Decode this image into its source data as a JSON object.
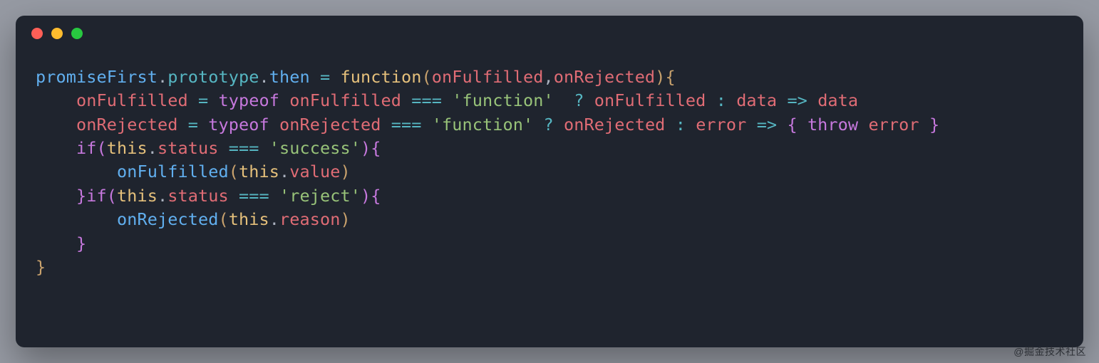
{
  "watermark": "@掘金技术社区",
  "colors": {
    "background": "#969aa3",
    "window": "#1f242e",
    "red": "#ff5f57",
    "yellow": "#febc2e",
    "green": "#28c840"
  },
  "code": {
    "language": "javascript",
    "plain": "promiseFirst.prototype.then = function(onFulfilled,onRejected){\n    onFulfilled = typeof onFulfilled === 'function'  ? onFulfilled : data => data\n    onRejected = typeof onRejected === 'function' ? onRejected : error => { throw error }\n    if(this.status === 'success'){\n        onFulfilled(this.value)\n    }if(this.status === 'reject'){\n        onRejected(this.reason)\n    }\n}",
    "tokens": [
      [
        {
          "t": "promiseFirst",
          "c": "c-id"
        },
        {
          "t": ".",
          "c": "c-punct"
        },
        {
          "t": "prototype",
          "c": "c-prop"
        },
        {
          "t": ".",
          "c": "c-punct"
        },
        {
          "t": "then",
          "c": "c-id"
        },
        {
          "t": " ",
          "c": ""
        },
        {
          "t": "=",
          "c": "c-op"
        },
        {
          "t": " ",
          "c": ""
        },
        {
          "t": "function",
          "c": "c-func"
        },
        {
          "t": "(",
          "c": "c-brace"
        },
        {
          "t": "onFulfilled",
          "c": "c-param"
        },
        {
          "t": ",",
          "c": "c-punct"
        },
        {
          "t": "onRejected",
          "c": "c-param"
        },
        {
          "t": ")",
          "c": "c-brace"
        },
        {
          "t": "{",
          "c": "c-brace"
        }
      ],
      [
        {
          "t": "    ",
          "c": ""
        },
        {
          "t": "onFulfilled",
          "c": "c-param"
        },
        {
          "t": " ",
          "c": ""
        },
        {
          "t": "=",
          "c": "c-op"
        },
        {
          "t": " ",
          "c": ""
        },
        {
          "t": "typeof",
          "c": "c-kw"
        },
        {
          "t": " ",
          "c": ""
        },
        {
          "t": "onFulfilled",
          "c": "c-param"
        },
        {
          "t": " ",
          "c": ""
        },
        {
          "t": "===",
          "c": "c-op"
        },
        {
          "t": " ",
          "c": ""
        },
        {
          "t": "'function'",
          "c": "c-str"
        },
        {
          "t": "  ",
          "c": ""
        },
        {
          "t": "?",
          "c": "c-op"
        },
        {
          "t": " ",
          "c": ""
        },
        {
          "t": "onFulfilled",
          "c": "c-param"
        },
        {
          "t": " ",
          "c": ""
        },
        {
          "t": ":",
          "c": "c-op"
        },
        {
          "t": " ",
          "c": ""
        },
        {
          "t": "data",
          "c": "c-param"
        },
        {
          "t": " ",
          "c": ""
        },
        {
          "t": "=>",
          "c": "c-op"
        },
        {
          "t": " ",
          "c": ""
        },
        {
          "t": "data",
          "c": "c-param"
        }
      ],
      [
        {
          "t": "    ",
          "c": ""
        },
        {
          "t": "onRejected",
          "c": "c-param"
        },
        {
          "t": " ",
          "c": ""
        },
        {
          "t": "=",
          "c": "c-op"
        },
        {
          "t": " ",
          "c": ""
        },
        {
          "t": "typeof",
          "c": "c-kw"
        },
        {
          "t": " ",
          "c": ""
        },
        {
          "t": "onRejected",
          "c": "c-param"
        },
        {
          "t": " ",
          "c": ""
        },
        {
          "t": "===",
          "c": "c-op"
        },
        {
          "t": " ",
          "c": ""
        },
        {
          "t": "'function'",
          "c": "c-str"
        },
        {
          "t": " ",
          "c": ""
        },
        {
          "t": "?",
          "c": "c-op"
        },
        {
          "t": " ",
          "c": ""
        },
        {
          "t": "onRejected",
          "c": "c-param"
        },
        {
          "t": " ",
          "c": ""
        },
        {
          "t": ":",
          "c": "c-op"
        },
        {
          "t": " ",
          "c": ""
        },
        {
          "t": "error",
          "c": "c-param"
        },
        {
          "t": " ",
          "c": ""
        },
        {
          "t": "=>",
          "c": "c-op"
        },
        {
          "t": " ",
          "c": ""
        },
        {
          "t": "{",
          "c": "c-brace2"
        },
        {
          "t": " ",
          "c": ""
        },
        {
          "t": "throw",
          "c": "c-kw"
        },
        {
          "t": " ",
          "c": ""
        },
        {
          "t": "error",
          "c": "c-param"
        },
        {
          "t": " ",
          "c": ""
        },
        {
          "t": "}",
          "c": "c-brace2"
        }
      ],
      [
        {
          "t": "    ",
          "c": ""
        },
        {
          "t": "if",
          "c": "c-kw"
        },
        {
          "t": "(",
          "c": "c-brace2"
        },
        {
          "t": "this",
          "c": "c-func"
        },
        {
          "t": ".",
          "c": "c-punct"
        },
        {
          "t": "status",
          "c": "c-param"
        },
        {
          "t": " ",
          "c": ""
        },
        {
          "t": "===",
          "c": "c-op"
        },
        {
          "t": " ",
          "c": ""
        },
        {
          "t": "'success'",
          "c": "c-str"
        },
        {
          "t": ")",
          "c": "c-brace2"
        },
        {
          "t": "{",
          "c": "c-brace2"
        }
      ],
      [
        {
          "t": "        ",
          "c": ""
        },
        {
          "t": "onFulfilled",
          "c": "c-id"
        },
        {
          "t": "(",
          "c": "c-brace"
        },
        {
          "t": "this",
          "c": "c-func"
        },
        {
          "t": ".",
          "c": "c-punct"
        },
        {
          "t": "value",
          "c": "c-param"
        },
        {
          "t": ")",
          "c": "c-brace"
        }
      ],
      [
        {
          "t": "    ",
          "c": ""
        },
        {
          "t": "}",
          "c": "c-brace2"
        },
        {
          "t": "if",
          "c": "c-kw"
        },
        {
          "t": "(",
          "c": "c-brace2"
        },
        {
          "t": "this",
          "c": "c-func"
        },
        {
          "t": ".",
          "c": "c-punct"
        },
        {
          "t": "status",
          "c": "c-param"
        },
        {
          "t": " ",
          "c": ""
        },
        {
          "t": "===",
          "c": "c-op"
        },
        {
          "t": " ",
          "c": ""
        },
        {
          "t": "'reject'",
          "c": "c-str"
        },
        {
          "t": ")",
          "c": "c-brace2"
        },
        {
          "t": "{",
          "c": "c-brace2"
        }
      ],
      [
        {
          "t": "        ",
          "c": ""
        },
        {
          "t": "onRejected",
          "c": "c-id"
        },
        {
          "t": "(",
          "c": "c-brace"
        },
        {
          "t": "this",
          "c": "c-func"
        },
        {
          "t": ".",
          "c": "c-punct"
        },
        {
          "t": "reason",
          "c": "c-param"
        },
        {
          "t": ")",
          "c": "c-brace"
        }
      ],
      [
        {
          "t": "    ",
          "c": ""
        },
        {
          "t": "}",
          "c": "c-brace2"
        }
      ],
      [
        {
          "t": "}",
          "c": "c-brace"
        }
      ]
    ]
  }
}
